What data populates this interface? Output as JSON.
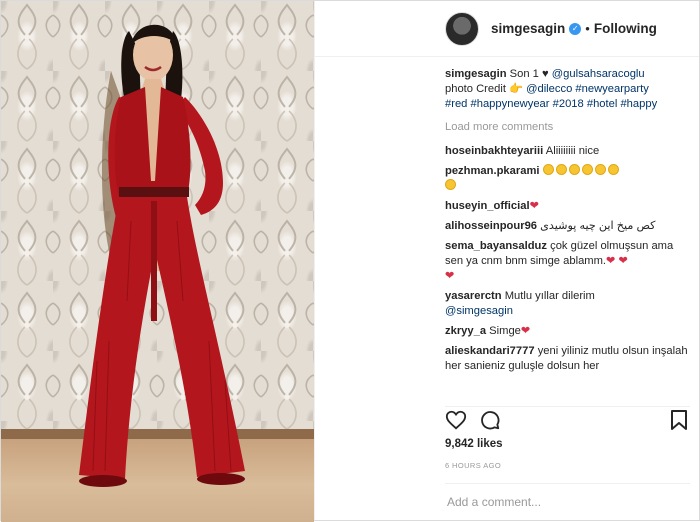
{
  "header": {
    "username": "simgesagin",
    "verified_glyph": "✓",
    "separator": "•",
    "follow_state": "Following"
  },
  "caption": {
    "username": "simgesagin",
    "text1": "Son 1",
    "heart": "♥",
    "mention": "@gulsahsaracoglu",
    "text2": "photo Credit",
    "pointer": "👉",
    "mention2": "@dilecco",
    "tags": [
      "#newyearparty",
      "#red",
      "#happynewyear",
      "#2018",
      "#hotel",
      "#happy"
    ]
  },
  "load_more": "Load more comments",
  "comments": [
    {
      "user": "hoseinbakhteyariii",
      "text": "Aliiiiiiii nice"
    },
    {
      "user": "pezhman.pkarami",
      "emoji_count": 7
    },
    {
      "user": "huseyin_official",
      "emoji": "heart"
    },
    {
      "user": "alihosseinpour96",
      "text": "کص میخ این چیه پوشیدی"
    },
    {
      "user": "sema_bayansalduz",
      "text": "çok güzel olmuşsun ama sen ya cnm bnm simge ablamm."
    },
    {
      "user": "yasarerctn",
      "text": "Mutlu yıllar dilerim",
      "mention": "@simgesagin"
    },
    {
      "user": "zkryy_a",
      "text": "Simge"
    },
    {
      "user": "alieskandari7777",
      "text": "yeni yiliniz mutlu olsun inşalah her sanieniz guluşle dolsun her"
    }
  ],
  "likes": "9,842 likes",
  "timestamp": "6 HOURS AGO",
  "add_comment_placeholder": "Add a comment...",
  "colors": {
    "link": "#003569",
    "verified": "#3897f0",
    "heart": "#d9304a",
    "dress": "#b3161c"
  },
  "icons": [
    "heart-icon",
    "comment-icon",
    "bookmark-icon",
    "verified-icon"
  ]
}
